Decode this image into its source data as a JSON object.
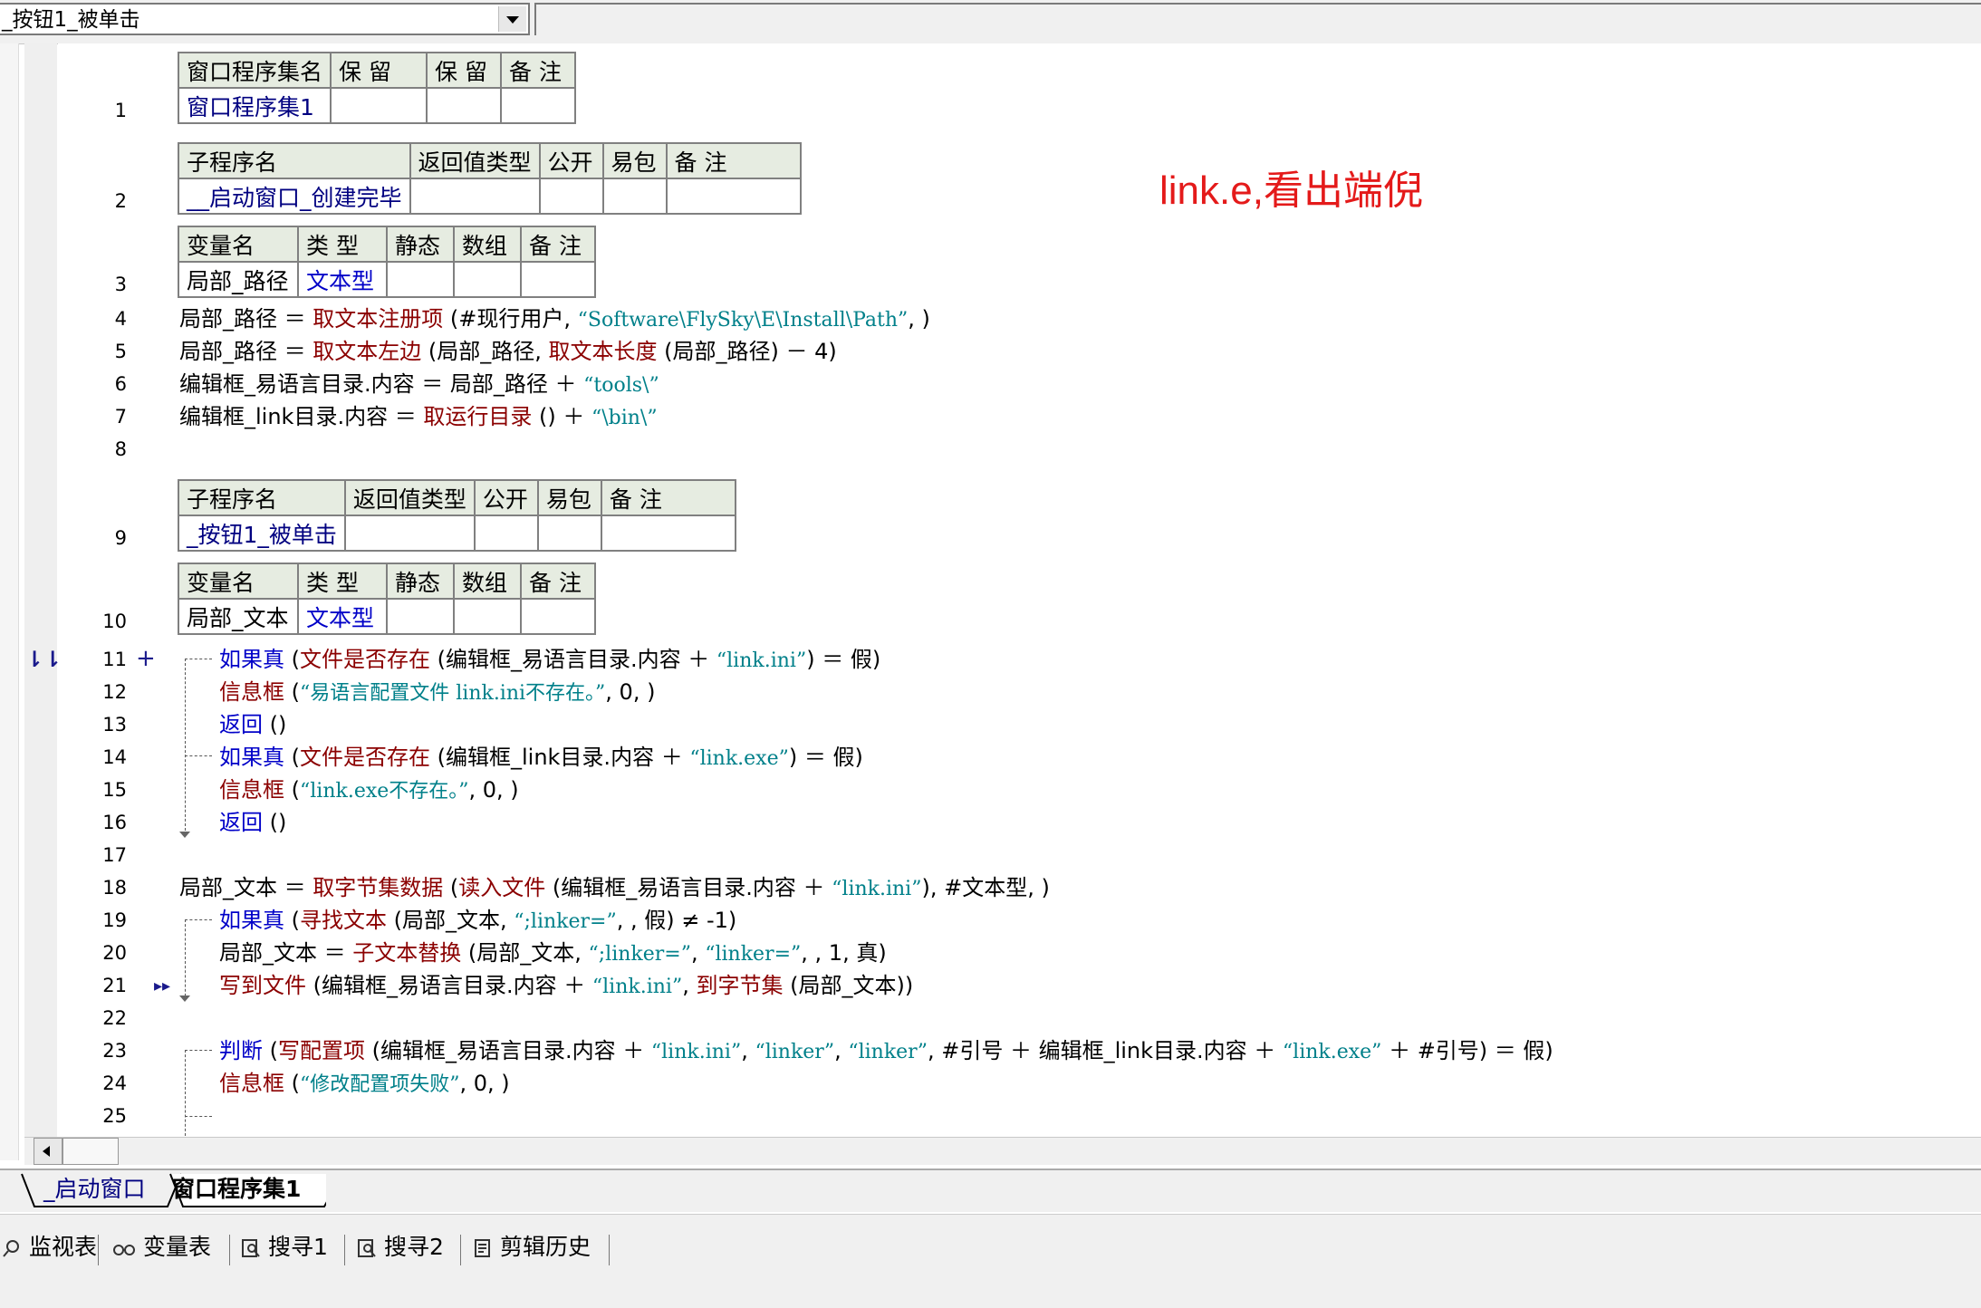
{
  "toolbar": {
    "subroutine_select": "_按钮1_被单击"
  },
  "annotation": "link.e,看出端倪",
  "line_numbers": [
    "1",
    "2",
    "3",
    "4",
    "5",
    "6",
    "7",
    "8",
    "9",
    "10",
    "11",
    "12",
    "13",
    "14",
    "15",
    "16",
    "17",
    "18",
    "19",
    "20",
    "21",
    "22",
    "23",
    "24",
    "25"
  ],
  "table_window_set": {
    "headers": [
      "窗口程序集名",
      "保 留",
      "保 留",
      "备 注"
    ],
    "row": [
      "窗口程序集1",
      "",
      "",
      ""
    ]
  },
  "table_sub1": {
    "headers": [
      "子程序名",
      "返回值类型",
      "公开",
      "易包",
      "备 注"
    ],
    "row": [
      "__启动窗口_创建完毕",
      "",
      "",
      "",
      ""
    ]
  },
  "table_var1": {
    "headers": [
      "变量名",
      "类 型",
      "静态",
      "数组",
      "备 注"
    ],
    "row": [
      "局部_路径",
      "文本型",
      "",
      "",
      ""
    ]
  },
  "table_sub2": {
    "headers": [
      "子程序名",
      "返回值类型",
      "公开",
      "易包",
      "备 注"
    ],
    "row": [
      "_按钮1_被单击",
      "",
      "",
      "",
      ""
    ]
  },
  "table_var2": {
    "headers": [
      "变量名",
      "类 型",
      "静态",
      "数组",
      "备 注"
    ],
    "row": [
      "局部_文本",
      "文本型",
      "",
      "",
      ""
    ]
  },
  "code": {
    "l4": [
      "局部_路径 ＝ ",
      "取文本注册项",
      " (#现行用户, ",
      "“Software\\FlySky\\E\\Install\\Path”",
      ", )"
    ],
    "l5": [
      "局部_路径 ＝ ",
      "取文本左边",
      " (局部_路径, ",
      "取文本长度",
      " (局部_路径) － 4)"
    ],
    "l6": [
      "编辑框_易语言目录.内容 ＝ 局部_路径 ＋ ",
      "“tools\\”"
    ],
    "l7": [
      "编辑框_link目录.内容 ＝ ",
      "取运行目录",
      " () ＋ ",
      "“\\bin\\”"
    ],
    "l11": [
      "如果真",
      " (",
      "文件是否存在",
      " (编辑框_易语言目录.内容 ＋ ",
      "“link.ini”",
      ") ＝ 假)"
    ],
    "l12": [
      "信息框",
      " (",
      "“易语言配置文件 link.ini不存在。”",
      ", 0, )"
    ],
    "l13": [
      "返回",
      " ()"
    ],
    "l14": [
      "如果真",
      " (",
      "文件是否存在",
      " (编辑框_link目录.内容 ＋ ",
      "“link.exe”",
      ") ＝ 假)"
    ],
    "l15": [
      "信息框",
      " (",
      "“link.exe不存在。”",
      ", 0, )"
    ],
    "l16": [
      "返回",
      " ()"
    ],
    "l18": [
      "局部_文本 ＝ ",
      "取字节集数据",
      " (",
      "读入文件",
      " (编辑框_易语言目录.内容 ＋ ",
      "“link.ini”",
      "), #文本型, )"
    ],
    "l19": [
      "如果真",
      " (",
      "寻找文本",
      " (局部_文本, ",
      "“;linker=”",
      ", , 假) ≠ -1)"
    ],
    "l20": [
      "局部_文本 ＝ ",
      "子文本替换",
      " (局部_文本, ",
      "“;linker=”",
      ", ",
      "“linker=”",
      ", , 1, 真)"
    ],
    "l21": [
      "写到文件",
      " (编辑框_易语言目录.内容 ＋ ",
      "“link.ini”",
      ", ",
      "到字节集",
      " (局部_文本))"
    ],
    "l23": [
      "判断",
      " (",
      "写配置项",
      " (编辑框_易语言目录.内容 ＋ ",
      "“link.ini”",
      ", ",
      "“linker”",
      ", ",
      "“linker”",
      ", #引号 ＋ 编辑框_link目录.内容 ＋ ",
      "“link.exe”",
      " ＋ #引号) ＝ 假)"
    ],
    "l24": [
      "信息框",
      " (",
      "“修改配置项失败”",
      ", 0, )"
    ]
  },
  "gutter_marks": {
    "line11_plus": "+"
  },
  "tabs": {
    "startup_window": "_启动窗口",
    "window_set": "窗口程序集1"
  },
  "bottom_tabs": {
    "watch": "监视表",
    "variables": "变量表",
    "search1": "搜寻1",
    "search2": "搜寻2",
    "clipboard": "剪辑历史"
  }
}
